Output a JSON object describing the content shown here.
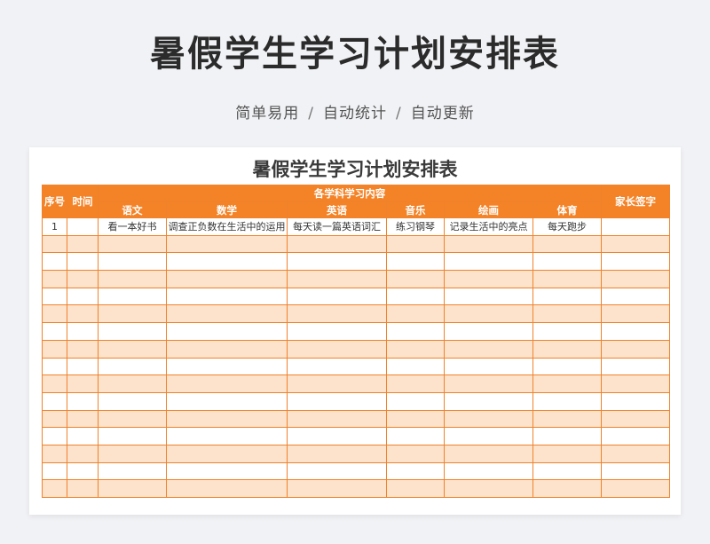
{
  "page": {
    "title": "暑假学生学习计划安排表",
    "subtitle_parts": [
      "简单易用",
      "/",
      "自动统计",
      "/",
      "自动更新"
    ]
  },
  "sheet": {
    "title": "暑假学生学习计划安排表",
    "headers": {
      "index": "序号",
      "time": "时间",
      "group": "各学科学习内容",
      "subjects": [
        "语文",
        "数学",
        "英语",
        "音乐",
        "绘画",
        "体育"
      ],
      "signature": "家长签字"
    },
    "rows": [
      [
        "1",
        "",
        "看一本好书",
        "调查正负数在生活中的运用",
        "每天读一篇英语词汇",
        "练习钢琴",
        "记录生活中的亮点",
        "每天跑步",
        ""
      ]
    ],
    "empty_row_count": 15,
    "colors": {
      "accent": "#f48327",
      "stripe": "#fde3cc",
      "border": "#f0822b"
    }
  }
}
